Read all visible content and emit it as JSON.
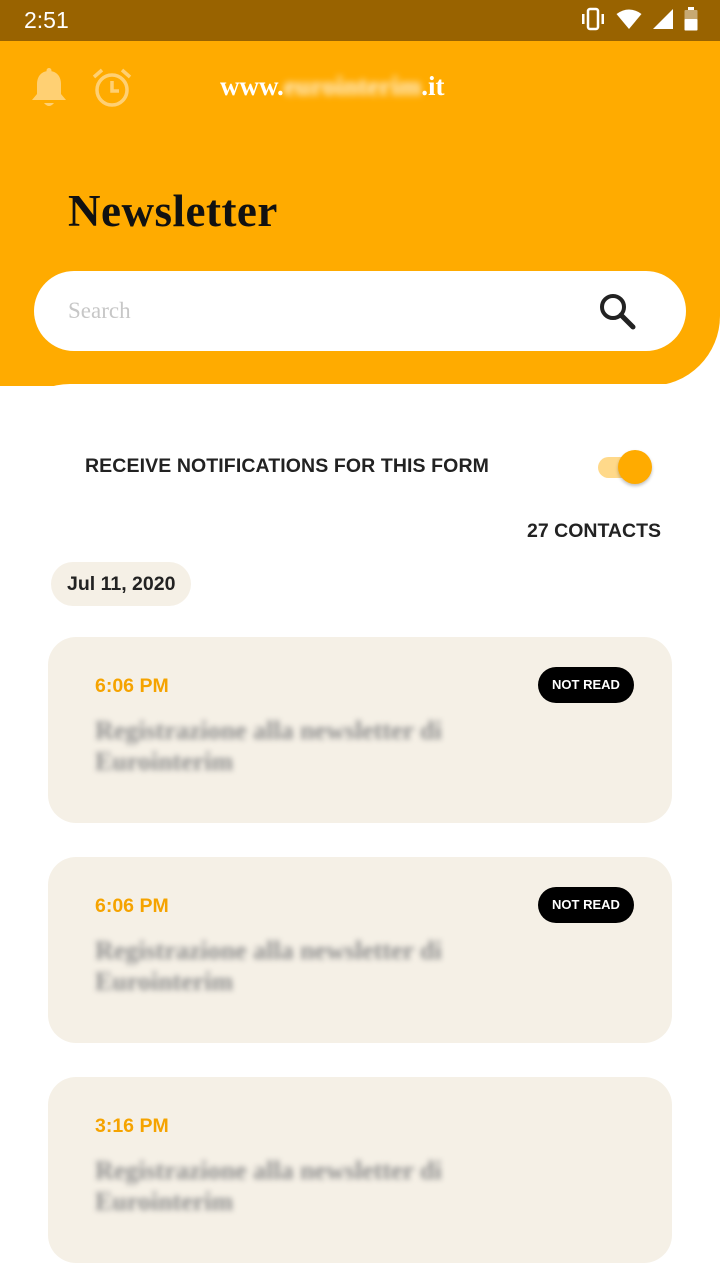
{
  "status_bar": {
    "time": "2:51",
    "icons": [
      "vibrate-icon",
      "wifi-icon",
      "signal-icon",
      "battery-icon"
    ]
  },
  "header": {
    "site_prefix": "www.",
    "site_blurred": "eurointerim",
    "site_suffix": ".it",
    "title": "Newsletter",
    "icons": [
      "bell-icon",
      "alarm-clock-icon"
    ],
    "accent_color": "#ffab00"
  },
  "search": {
    "placeholder": "Search"
  },
  "notifications": {
    "label": "RECEIVE NOTIFICATIONS FOR THIS FORM",
    "enabled": true
  },
  "contacts_count": "27 CONTACTS",
  "date_group": "Jul 11, 2020",
  "cards": [
    {
      "time": "6:06 PM",
      "badge": "NOT READ",
      "text": "Registrazione alla newsletter di Eurointerim"
    },
    {
      "time": "6:06 PM",
      "badge": "NOT READ",
      "text": "Registrazione alla newsletter di Eurointerim"
    },
    {
      "time": "3:16 PM",
      "badge": "",
      "text": "Registrazione alla newsletter di Eurointerim"
    }
  ]
}
